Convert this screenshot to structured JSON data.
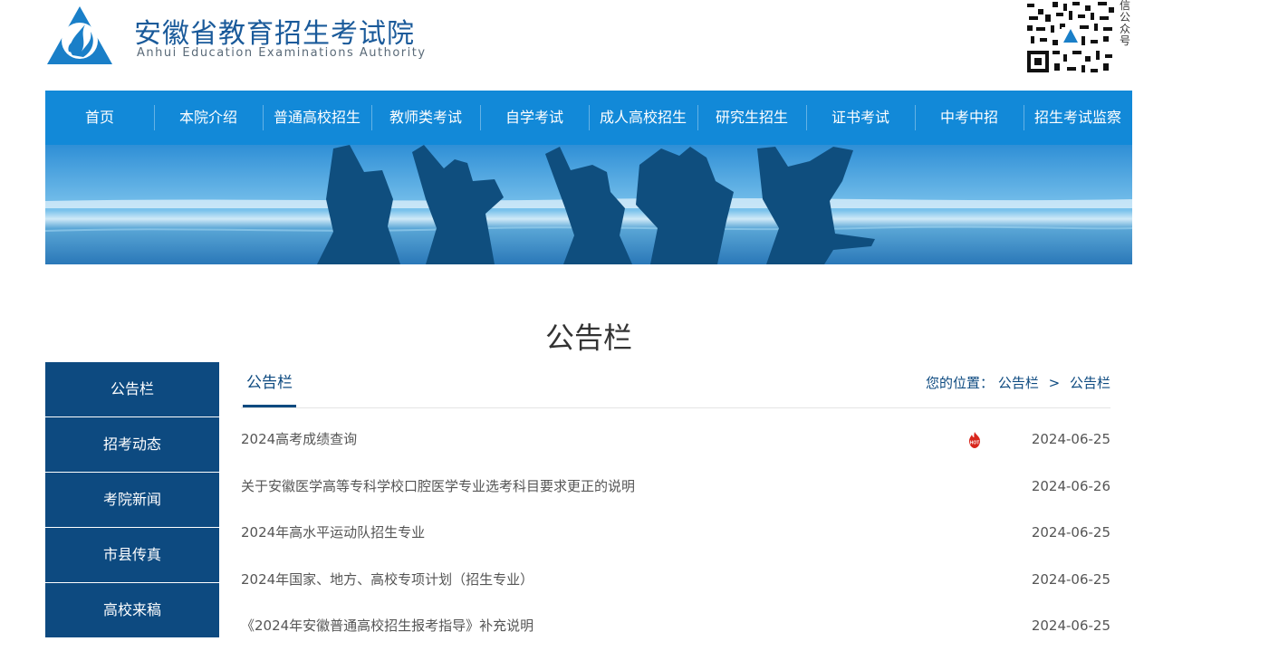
{
  "header": {
    "site_name_cn": "安徽省教育招生考试院",
    "site_name_en": "Anhui Education Examinations Authority",
    "qr_label": "信公众号"
  },
  "nav": [
    {
      "label": "首页"
    },
    {
      "label": "本院介绍"
    },
    {
      "label": "普通高校招生"
    },
    {
      "label": "教师类考试"
    },
    {
      "label": "自学考试"
    },
    {
      "label": "成人高校招生"
    },
    {
      "label": "研究生招生"
    },
    {
      "label": "证书考试"
    },
    {
      "label": "中考中招"
    },
    {
      "label": "招生考试监察"
    }
  ],
  "page_title": "公告栏",
  "sidebar": [
    {
      "label": "公告栏"
    },
    {
      "label": "招考动态"
    },
    {
      "label": "考院新闻"
    },
    {
      "label": "市县传真"
    },
    {
      "label": "高校来稿"
    }
  ],
  "content": {
    "tab_title": "公告栏",
    "breadcrumb": {
      "prefix": "您的位置：",
      "items": [
        "公告栏",
        "公告栏"
      ],
      "separator": ">"
    },
    "list": [
      {
        "title": "2024高考成绩查询",
        "date": "2024-06-25",
        "hot": true
      },
      {
        "title": "关于安徽医学高等专科学校口腔医学专业选考科目要求更正的说明",
        "date": "2024-06-26",
        "hot": false
      },
      {
        "title": "2024年高水平运动队招生专业",
        "date": "2024-06-25",
        "hot": false
      },
      {
        "title": "2024年国家、地方、高校专项计划（招生专业）",
        "date": "2024-06-25",
        "hot": false
      },
      {
        "title": "《2024年安徽普通高校招生报考指导》补充说明",
        "date": "2024-06-25",
        "hot": false
      }
    ]
  },
  "colors": {
    "nav_blue": "#1289d8",
    "sidebar_navy": "#0d4a80",
    "accent": "#1a5a9a",
    "hot_red": "#d8261c"
  },
  "icons": {
    "logo": "triangle-flame-logo",
    "qr": "wechat-qr-code",
    "hot": "hot-flame-icon"
  }
}
